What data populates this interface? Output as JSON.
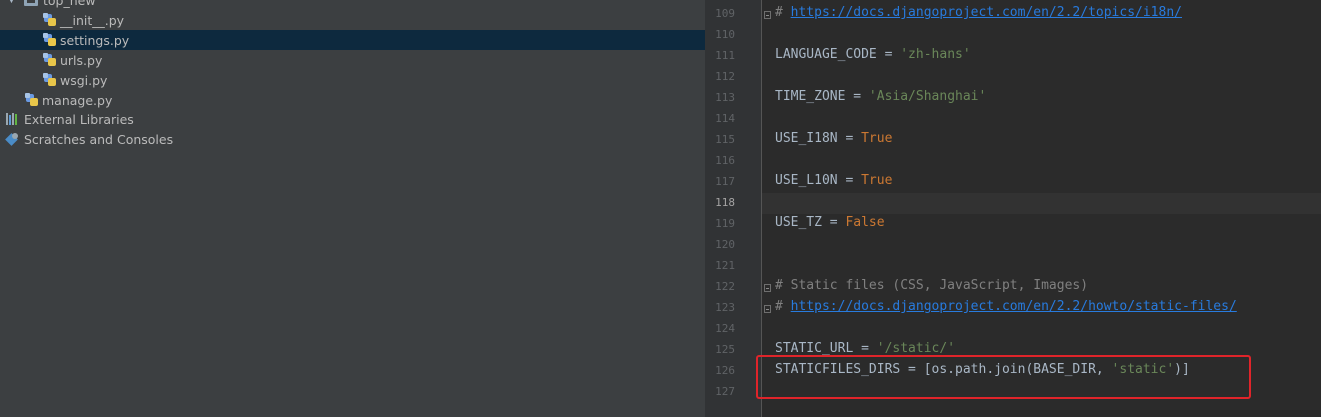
{
  "project_tree": {
    "items": [
      {
        "label": "top_new",
        "type": "folder",
        "expanded": true
      },
      {
        "label": "__init__.py",
        "type": "py"
      },
      {
        "label": "settings.py",
        "type": "py",
        "selected": true
      },
      {
        "label": "urls.py",
        "type": "py"
      },
      {
        "label": "wsgi.py",
        "type": "py"
      },
      {
        "label": "manage.py",
        "type": "py"
      },
      {
        "label": "External Libraries",
        "type": "libs"
      },
      {
        "label": "Scratches and Consoles",
        "type": "scratch"
      }
    ]
  },
  "editor": {
    "current_line": "118",
    "line_numbers": [
      "109",
      "110",
      "111",
      "112",
      "113",
      "114",
      "115",
      "116",
      "117",
      "118",
      "119",
      "120",
      "121",
      "122",
      "123",
      "124",
      "125",
      "126",
      "127"
    ],
    "code": {
      "l109_hash": "# ",
      "l109_url": "https://docs.djangoproject.com/en/2.2/topics/i18n/",
      "l111_name": "LANGUAGE_CODE = ",
      "l111_value": "'zh-hans'",
      "l113_name": "TIME_ZONE = ",
      "l113_value": "'Asia/Shanghai'",
      "l115_name": "USE_I18N = ",
      "l115_value": "True",
      "l117_name": "USE_L10N = ",
      "l117_value": "True",
      "l119_name": "USE_TZ = ",
      "l119_value": "False",
      "l122_comment": "# Static files (CSS, JavaScript, Images)",
      "l123_hash": "# ",
      "l123_url": "https://docs.djangoproject.com/en/2.2/howto/static-files/",
      "l125_name": "STATIC_URL = ",
      "l125_value": "'/static/'",
      "l126_start": "STATICFILES_DIRS = [os.path.join(BASE_DIR, ",
      "l126_value": "'static'",
      "l126_end": ")]"
    }
  },
  "colors": {
    "highlight_box": "#e0242a",
    "selection": "#0d293e",
    "string": "#6a8759",
    "keyword": "#cc7832",
    "url": "#287bde",
    "comment": "#808080"
  }
}
